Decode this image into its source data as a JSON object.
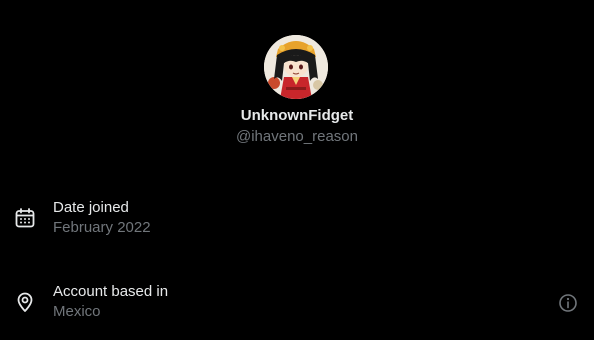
{
  "profile": {
    "display_name": "UnknownFidget",
    "handle": "@ihaveno_reason"
  },
  "about": {
    "date_joined": {
      "label": "Date joined",
      "value": "February 2022",
      "icon": "calendar-icon"
    },
    "account_location": {
      "label": "Account based in",
      "value": "Mexico",
      "icon": "location-pin-icon",
      "action_icon": "info-icon"
    }
  },
  "colors": {
    "background": "#000000",
    "primary_text": "#e7e9ea",
    "secondary_text": "#71767b"
  }
}
